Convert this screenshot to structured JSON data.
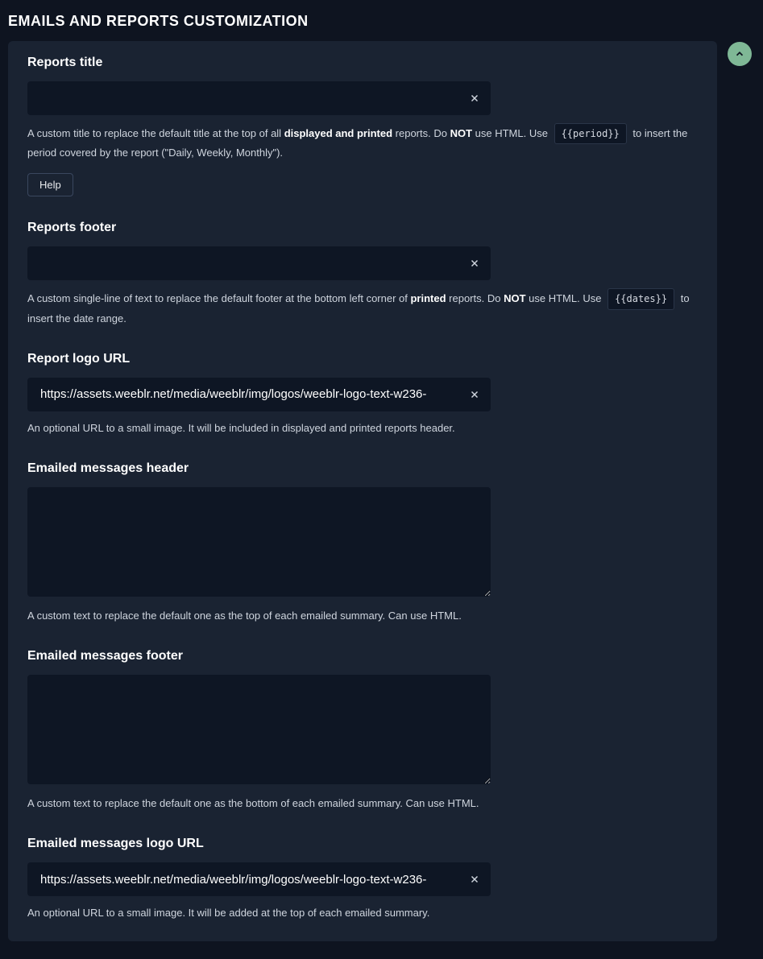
{
  "page_title": "EMAILS AND REPORTS CUSTOMIZATION",
  "fields": {
    "reports_title": {
      "label": "Reports title",
      "value": "",
      "help_pre": "A custom title to replace the default title at the top of all ",
      "help_bold1": "displayed and printed",
      "help_mid1": " reports. Do ",
      "help_bold2": "NOT",
      "help_mid2": " use HTML. Use ",
      "help_code": "{{period}}",
      "help_post": " to insert the period covered by the report (\"Daily, Weekly, Monthly\").",
      "help_button": "Help"
    },
    "reports_footer": {
      "label": "Reports footer",
      "value": "",
      "help_pre": "A custom single-line of text to replace the default footer at the bottom left corner of ",
      "help_bold1": "printed",
      "help_mid1": " reports. Do ",
      "help_bold2": "NOT",
      "help_mid2": " use HTML. Use ",
      "help_code": "{{dates}}",
      "help_post": " to insert the date range."
    },
    "report_logo_url": {
      "label": "Report logo URL",
      "value": "https://assets.weeblr.net/media/weeblr/img/logos/weeblr-logo-text-w236-",
      "help": "An optional URL to a small image. It will be included in displayed and printed reports header."
    },
    "emailed_header": {
      "label": "Emailed messages header",
      "value": "",
      "help": "A custom text to replace the default one as the top of each emailed summary. Can use HTML."
    },
    "emailed_footer": {
      "label": "Emailed messages footer",
      "value": "",
      "help": "A custom text to replace the default one as the bottom of each emailed summary. Can use HTML."
    },
    "emailed_logo_url": {
      "label": "Emailed messages logo URL",
      "value": "https://assets.weeblr.net/media/weeblr/img/logos/weeblr-logo-text-w236-",
      "help": "An optional URL to a small image. It will be added at the top of each emailed summary."
    }
  }
}
